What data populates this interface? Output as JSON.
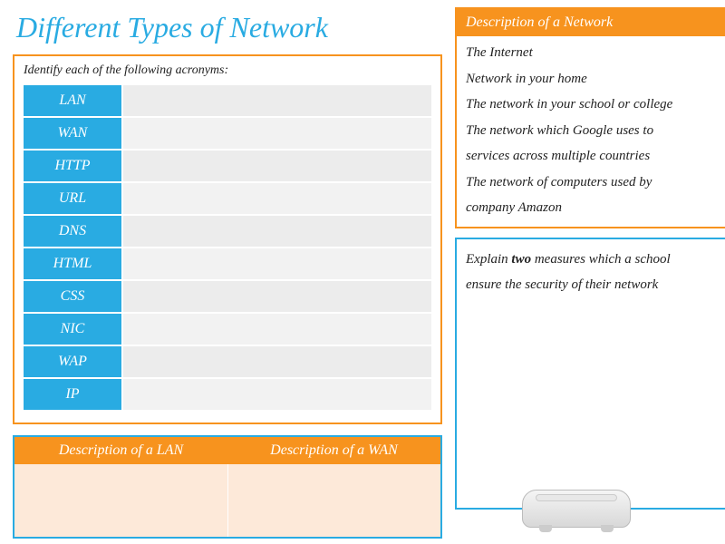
{
  "title": "Different Types of Network",
  "acronyms": {
    "instruction": "Identify each of the following acronyms:",
    "items": [
      "LAN",
      "WAN",
      "HTTP",
      "URL",
      "DNS",
      "HTML",
      "CSS",
      "NIC",
      "WAP",
      "IP"
    ]
  },
  "lan_wan": {
    "lan_head": "Description of a LAN",
    "wan_head": "Description of a WAN"
  },
  "desc_network": {
    "head": "Description of a Network",
    "lines": [
      "The Internet",
      "Network in your home",
      "The network in your school or college",
      "The network which Google uses to",
      "services across multiple countries",
      "The network of computers used by",
      "company Amazon"
    ]
  },
  "security": {
    "line1_a": "Explain ",
    "line1_b": "two",
    "line1_c": " measures which a school",
    "line2": "ensure the security of their network"
  }
}
